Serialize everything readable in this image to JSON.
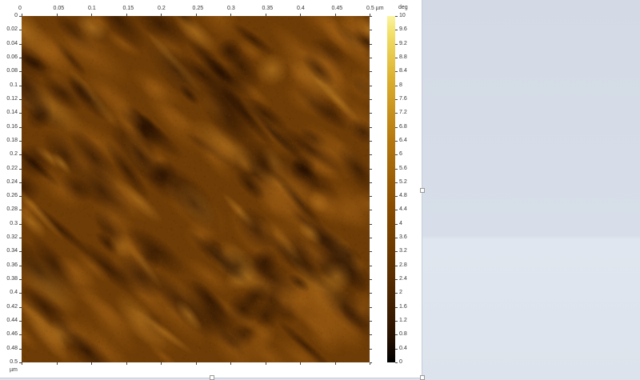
{
  "chart_data": {
    "type": "heatmap",
    "title": "AFM phase image",
    "x_ticks": [
      0,
      0.05,
      0.1,
      0.15,
      0.2,
      0.25,
      0.3,
      0.35,
      0.4,
      0.45,
      0.5
    ],
    "x_tick_labels": [
      "0",
      "0.05",
      "0.1",
      "0.15",
      "0.2",
      "0.25",
      "0.3",
      "0.35",
      "0.4",
      "0.45",
      "0.5 µm"
    ],
    "y_ticks": [
      0,
      0.02,
      0.04,
      0.06,
      0.08,
      0.1,
      0.12,
      0.14,
      0.16,
      0.18,
      0.2,
      0.22,
      0.24,
      0.26,
      0.28,
      0.3,
      0.32,
      0.34,
      0.36,
      0.38,
      0.4,
      0.42,
      0.44,
      0.46,
      0.48,
      0.5
    ],
    "y_tick_labels": [
      "0",
      "0.02",
      "0.04",
      "0.06",
      "0.08",
      "0.1",
      "0.12",
      "0.14",
      "0.16",
      "0.18",
      "0.2",
      "0.22",
      "0.24",
      "0.26",
      "0.28",
      "0.3",
      "0.32",
      "0.34",
      "0.36",
      "0.38",
      "0.4",
      "0.42",
      "0.44",
      "0.46",
      "0.48",
      "0.5"
    ],
    "y_unit": "µm",
    "xlim": [
      0,
      0.5
    ],
    "ylim": [
      0,
      0.5
    ],
    "colorbar": {
      "unit": "deg",
      "range": [
        0,
        10
      ],
      "ticks": [
        0,
        0.4,
        0.8,
        1.2,
        1.6,
        2,
        2.4,
        2.8,
        3.2,
        3.6,
        4,
        4.4,
        4.8,
        5.2,
        5.6,
        6,
        6.4,
        6.8,
        7.2,
        7.6,
        8,
        8.4,
        8.8,
        9.2,
        9.6,
        10
      ],
      "tick_labels": [
        "0",
        "0.4",
        "0.8",
        "1.2",
        "1.6",
        "2",
        "2.4",
        "2.8",
        "3.2",
        "3.6",
        "4",
        "4.4",
        "4.8",
        "5.2",
        "5.6",
        "6",
        "6.4",
        "6.8",
        "7.2",
        "7.6",
        "8",
        "8.4",
        "8.8",
        "9.2",
        "9.6",
        "10"
      ]
    },
    "colors": {
      "low": "#000000",
      "mid": "#8a4d00",
      "high": "#fbf4a0"
    }
  }
}
